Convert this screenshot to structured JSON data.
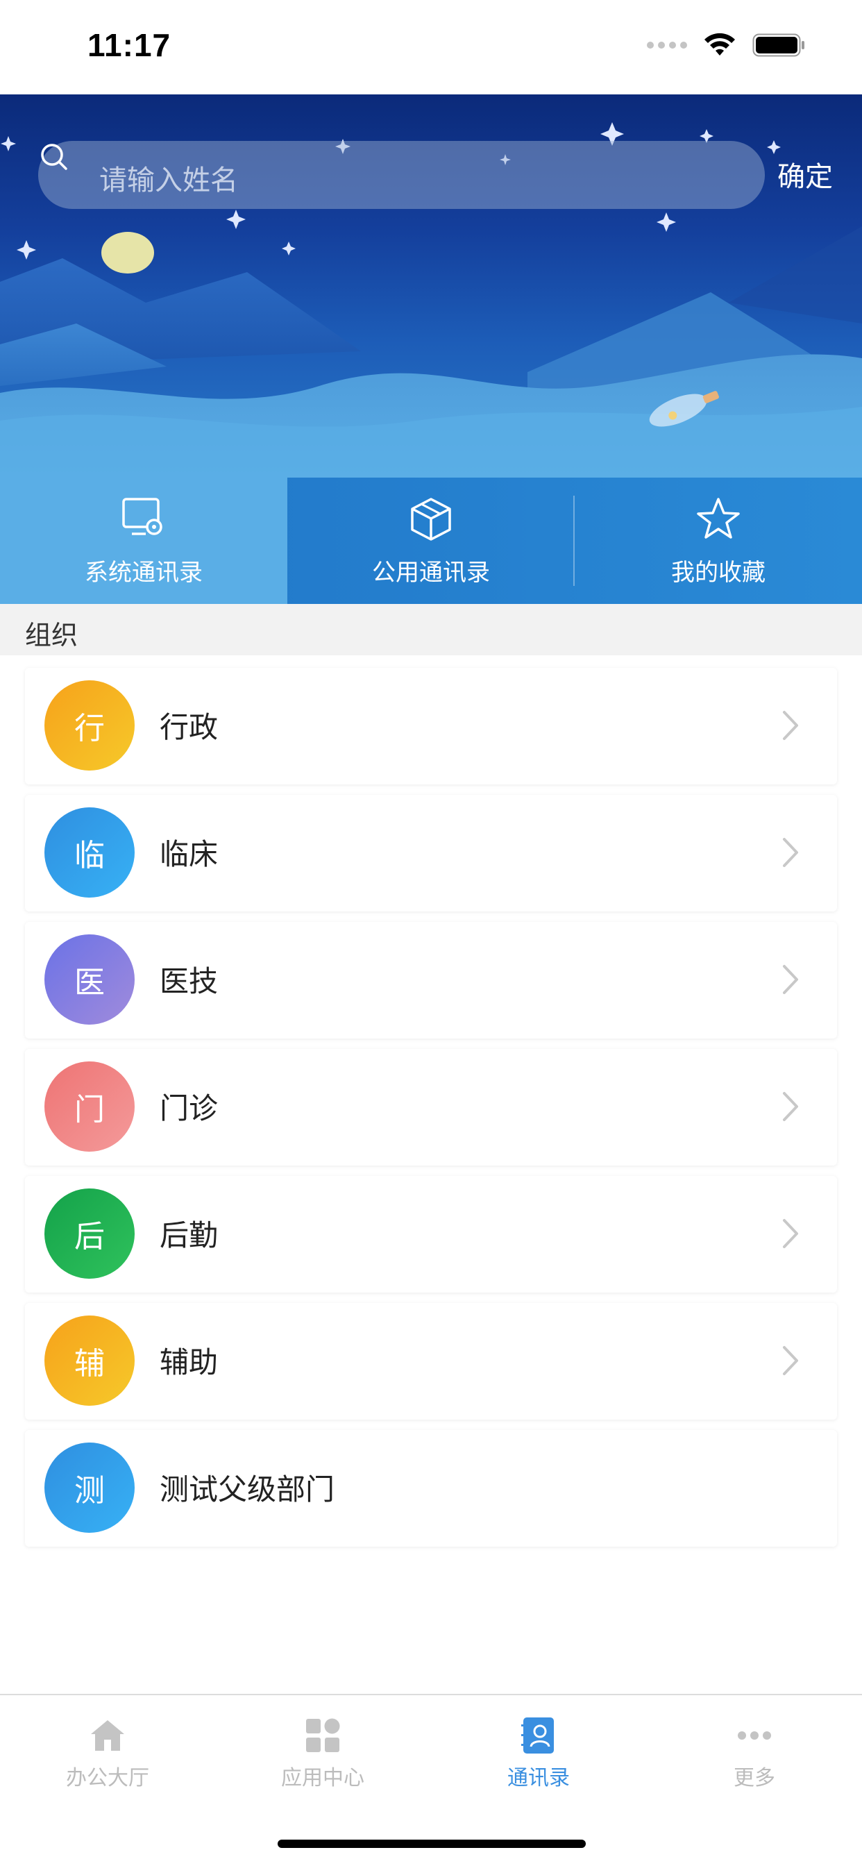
{
  "status_bar": {
    "time": "11:17"
  },
  "search": {
    "placeholder": "请输入姓名",
    "confirm_label": "确定"
  },
  "tabs": [
    {
      "label": "系统通讯录",
      "icon": "monitor-settings-icon",
      "active": true
    },
    {
      "label": "公用通讯录",
      "icon": "cube-icon",
      "active": false
    },
    {
      "label": "我的收藏",
      "icon": "star-icon",
      "active": false
    }
  ],
  "section": {
    "title": "组织"
  },
  "org_list": [
    {
      "avatar_char": "行",
      "label": "行政",
      "colors": [
        "#f7a21b",
        "#f5c92a"
      ],
      "has_chevron": true
    },
    {
      "avatar_char": "临",
      "label": "临床",
      "colors": [
        "#2f8fe0",
        "#37b1f5"
      ],
      "has_chevron": true
    },
    {
      "avatar_char": "医",
      "label": "医技",
      "colors": [
        "#6b72e6",
        "#a08bdc"
      ],
      "has_chevron": true
    },
    {
      "avatar_char": "门",
      "label": "门诊",
      "colors": [
        "#ee7474",
        "#f49a9a"
      ],
      "has_chevron": true
    },
    {
      "avatar_char": "后",
      "label": "后勤",
      "colors": [
        "#14a24a",
        "#2fc25c"
      ],
      "has_chevron": true
    },
    {
      "avatar_char": "辅",
      "label": "辅助",
      "colors": [
        "#f7a21b",
        "#f5c92a"
      ],
      "has_chevron": true
    },
    {
      "avatar_char": "测",
      "label": "测试父级部门",
      "colors": [
        "#2f8fe0",
        "#37b1f5"
      ],
      "has_chevron": false
    }
  ],
  "bottom_nav": [
    {
      "label": "办公大厅",
      "icon": "home-icon",
      "active": false
    },
    {
      "label": "应用中心",
      "icon": "apps-grid-icon",
      "active": false
    },
    {
      "label": "通讯录",
      "icon": "contacts-icon",
      "active": true
    },
    {
      "label": "更多",
      "icon": "more-dots-icon",
      "active": false
    }
  ],
  "colors": {
    "accent": "#3a8fe0",
    "inactive_nav": "#bcbcbc"
  }
}
